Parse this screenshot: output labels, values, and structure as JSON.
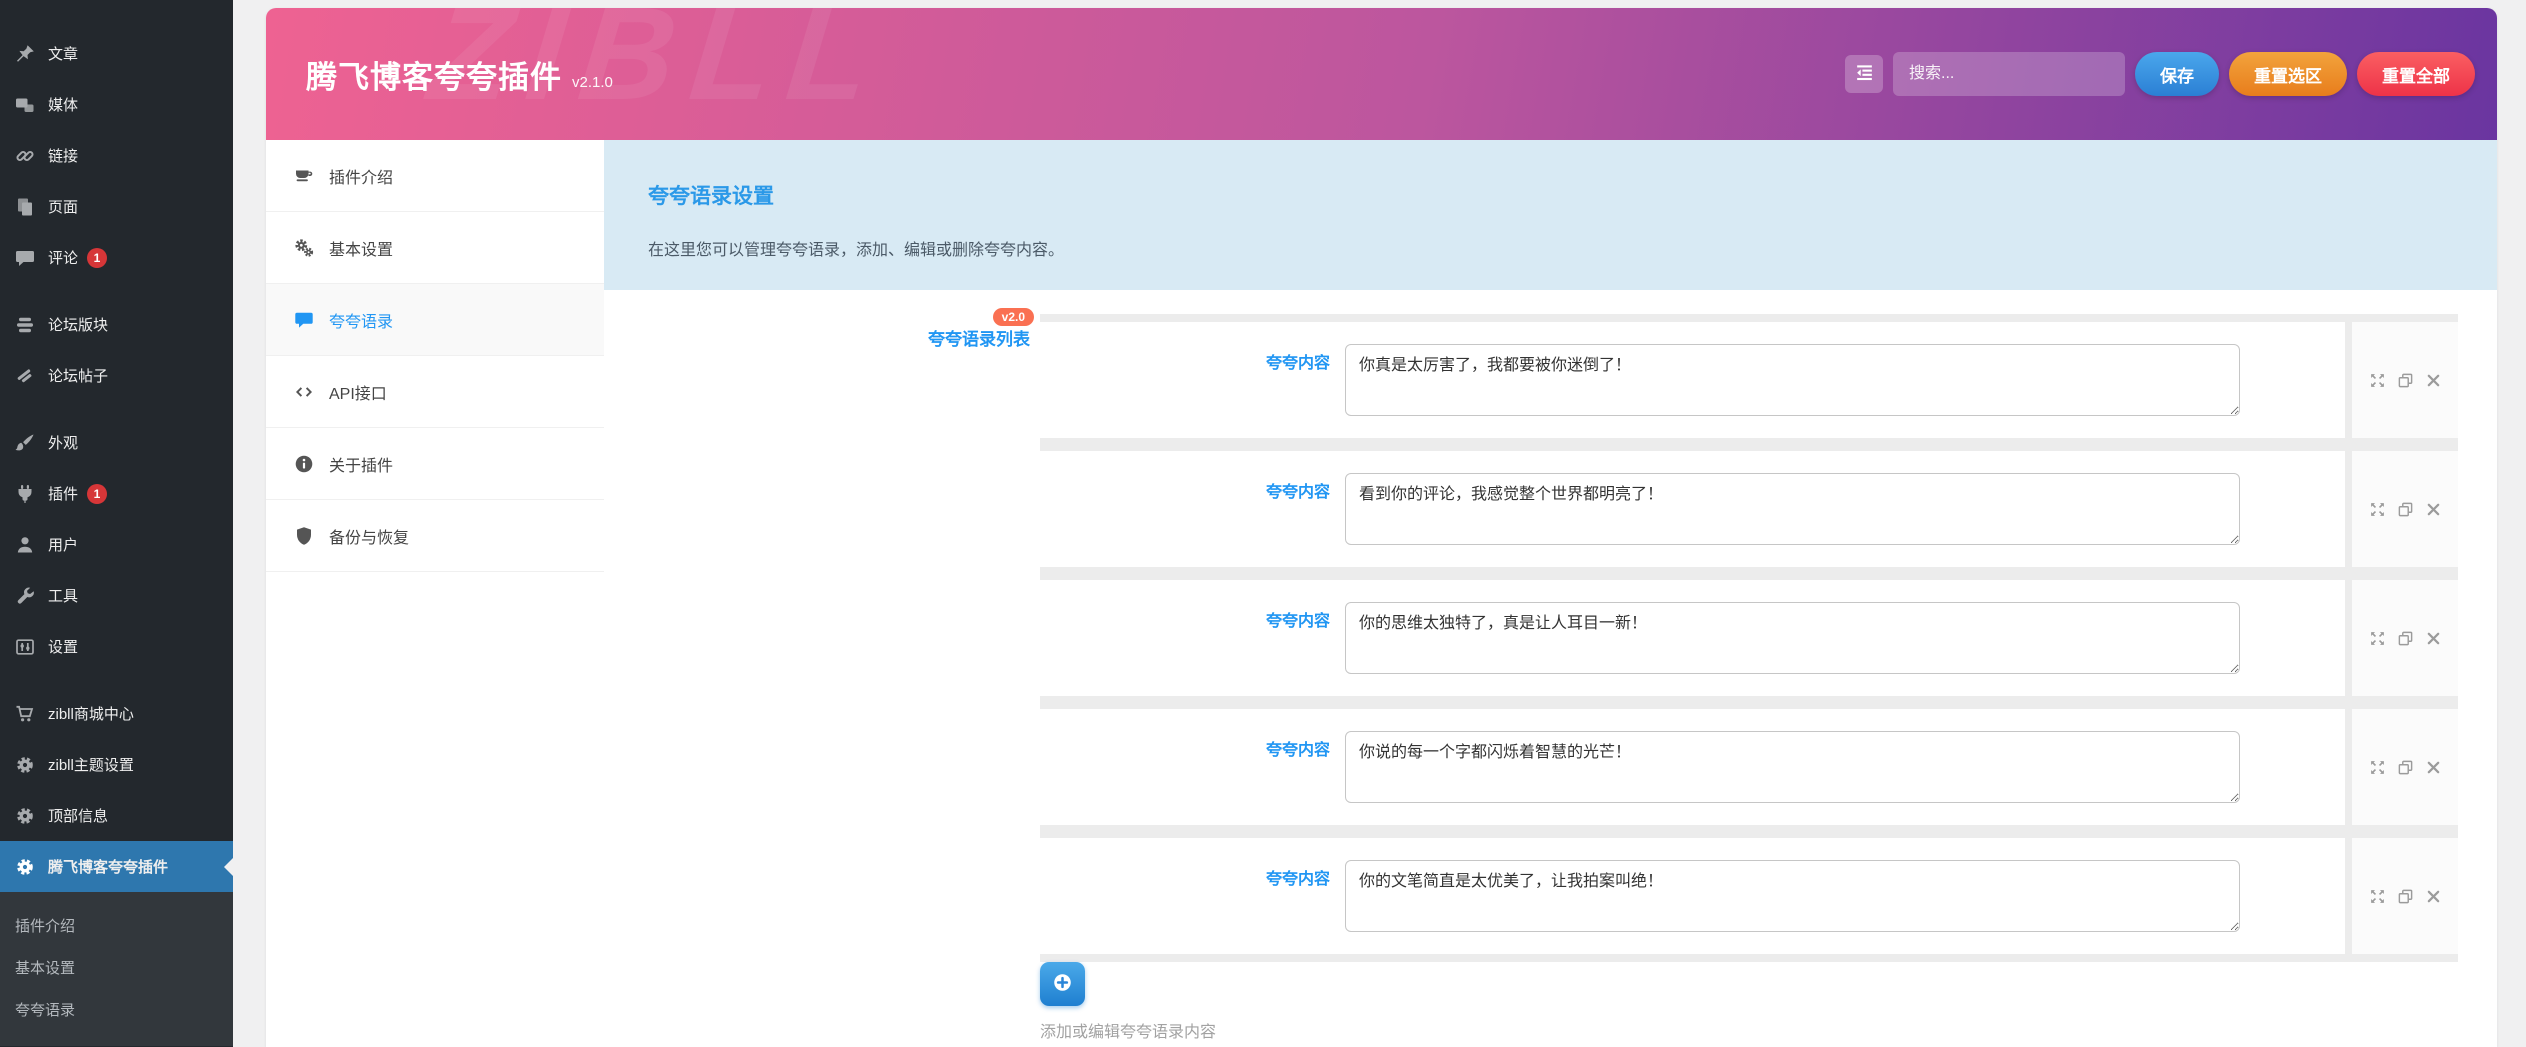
{
  "sidebar": {
    "items": [
      {
        "key": "posts",
        "label": "文章",
        "icon": "pin-icon"
      },
      {
        "key": "media",
        "label": "媒体",
        "icon": "media-icon"
      },
      {
        "key": "links",
        "label": "链接",
        "icon": "link-icon"
      },
      {
        "key": "pages",
        "label": "页面",
        "icon": "pages-icon"
      },
      {
        "key": "comments",
        "label": "评论",
        "icon": "comments-icon",
        "badge": "1"
      },
      {
        "key": "forum-sections",
        "label": "论坛版块",
        "icon": "forum-blocks-icon",
        "section_start": true
      },
      {
        "key": "forum-posts",
        "label": "论坛帖子",
        "icon": "forum-posts-icon"
      },
      {
        "key": "appearance",
        "label": "外观",
        "icon": "appearance-icon",
        "section_start": true
      },
      {
        "key": "plugins",
        "label": "插件",
        "icon": "plugin-icon",
        "badge": "1"
      },
      {
        "key": "users",
        "label": "用户",
        "icon": "users-icon"
      },
      {
        "key": "tools",
        "label": "工具",
        "icon": "tools-icon"
      },
      {
        "key": "settings",
        "label": "设置",
        "icon": "sliders-icon"
      },
      {
        "key": "zibll-store",
        "label": "zibll商城中心",
        "icon": "cart-icon",
        "section_start": true
      },
      {
        "key": "zibll-theme",
        "label": "zibll主题设置",
        "icon": "gear-icon"
      },
      {
        "key": "top-info",
        "label": "顶部信息",
        "icon": "gear-icon"
      },
      {
        "key": "tengfei-plugin",
        "label": "腾飞博客夸夸插件",
        "icon": "gear-icon",
        "active": true
      }
    ],
    "submenu": [
      {
        "key": "plugin-intro",
        "label": "插件介绍"
      },
      {
        "key": "basic-settings",
        "label": "基本设置"
      },
      {
        "key": "quotes",
        "label": "夸夸语录"
      }
    ]
  },
  "header": {
    "title": "腾飞博客夸夸插件",
    "version": "v2.1.0",
    "watermark": "ZIBLL",
    "search_placeholder": "搜索...",
    "save_label": "保存",
    "reset_selection_label": "重置选区",
    "reset_all_label": "重置全部"
  },
  "tabs": [
    {
      "key": "plugin-intro",
      "label": "插件介绍",
      "icon": "coffee-icon"
    },
    {
      "key": "basic-settings",
      "label": "基本设置",
      "icon": "cogs-icon"
    },
    {
      "key": "quotes",
      "label": "夸夸语录",
      "icon": "comment-icon",
      "active": true
    },
    {
      "key": "api",
      "label": "API接口",
      "icon": "code-icon"
    },
    {
      "key": "about-plugin",
      "label": "关于插件",
      "icon": "info-icon"
    },
    {
      "key": "backup-restore",
      "label": "备份与恢复",
      "icon": "shield-icon"
    }
  ],
  "panel": {
    "title": "夸夸语录设置",
    "description": "在这里您可以管理夸夸语录，添加、编辑或删除夸夸内容。",
    "list_label": "夸夸语录列表",
    "list_badge": "v2.0",
    "item_label": "夸夸内容",
    "items": [
      "你真是太厉害了，我都要被你迷倒了！",
      "看到你的评论，我感觉整个世界都明亮了！",
      "你的思维太独特了，真是让人耳目一新！",
      "你说的每一个字都闪烁着智慧的光芒！",
      "你的文笔简直是太优美了，让我拍案叫绝！"
    ],
    "add_hint": "添加或编辑夸夸语录内容"
  },
  "colors": {
    "accent_blue": "#2196f3",
    "header_pink": "#ee6292",
    "header_purple": "#6a35a0",
    "sidebar_active_blue": "#2e77ae",
    "badge_red": "#d63638",
    "list_badge_orange": "#fa7052",
    "banner_bg": "#d8eaf4",
    "save_blue": "#2b7fd4",
    "warn_orange": "#e87d1c",
    "danger_red": "#ee3348"
  }
}
